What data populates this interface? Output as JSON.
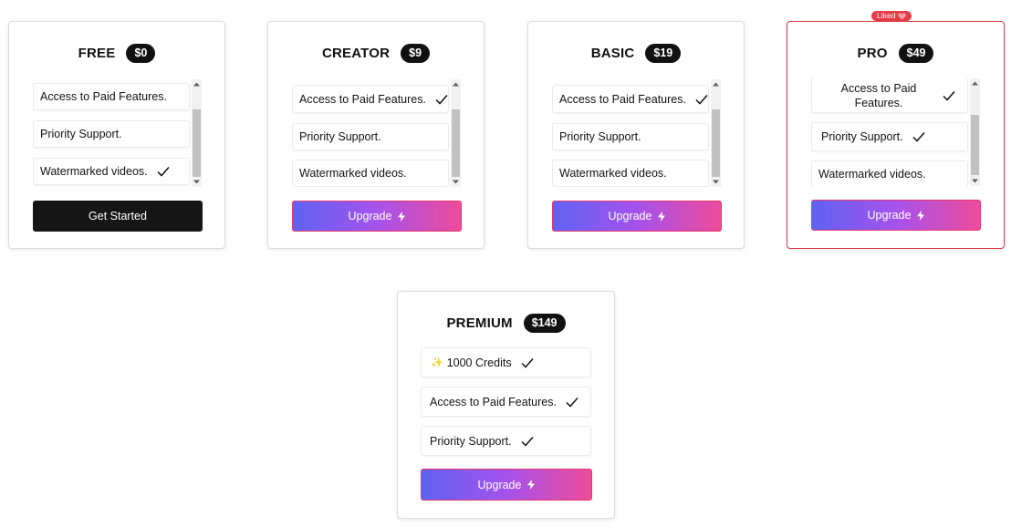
{
  "colors": {
    "dark": "#161616",
    "gradient_start": "#5f63f2",
    "gradient_mid": "#a552ec",
    "gradient_end": "#ee4c9a",
    "liked_red": "#e63c48"
  },
  "plans": [
    {
      "name": "FREE",
      "price": "$0",
      "features": [
        {
          "text": "Access to Paid Features.",
          "check": false
        },
        {
          "text": "Priority Support.",
          "check": false
        },
        {
          "text": "Watermarked videos.",
          "check": true
        }
      ],
      "button": {
        "label": "Get Started",
        "style": "dark",
        "icon": null
      }
    },
    {
      "name": "CREATOR",
      "price": "$9",
      "features": [
        {
          "text": "Access to Paid Features.",
          "check": true
        },
        {
          "text": "Priority Support.",
          "check": false
        },
        {
          "text": "Watermarked videos.",
          "check": false
        }
      ],
      "button": {
        "label": "Upgrade",
        "style": "gradient",
        "icon": "bolt-icon"
      }
    },
    {
      "name": "BASIC",
      "price": "$19",
      "features": [
        {
          "text": "Access to Paid Features.",
          "check": true
        },
        {
          "text": "Priority Support.",
          "check": false
        },
        {
          "text": "Watermarked videos.",
          "check": false
        }
      ],
      "button": {
        "label": "Upgrade",
        "style": "gradient",
        "icon": "bolt-icon"
      }
    },
    {
      "name": "PRO",
      "price": "$49",
      "liked": true,
      "liked_label": "Liked",
      "liked_icon": "heart-icon",
      "features": [
        {
          "text": "Access to Paid Features.",
          "check": true
        },
        {
          "text": "Priority Support.",
          "check": true
        },
        {
          "text": "Watermarked videos.",
          "check": false
        }
      ],
      "button": {
        "label": "Upgrade",
        "style": "gradient",
        "icon": "bolt-icon"
      }
    },
    {
      "name": "PREMIUM",
      "price": "$149",
      "features": [
        {
          "text": "1000 Credits",
          "check": true,
          "icon": "sparkle-icon"
        },
        {
          "text": "Access to Paid Features.",
          "check": true
        },
        {
          "text": "Priority Support.",
          "check": true
        }
      ],
      "button": {
        "label": "Upgrade",
        "style": "gradient",
        "icon": "bolt-icon"
      }
    }
  ]
}
